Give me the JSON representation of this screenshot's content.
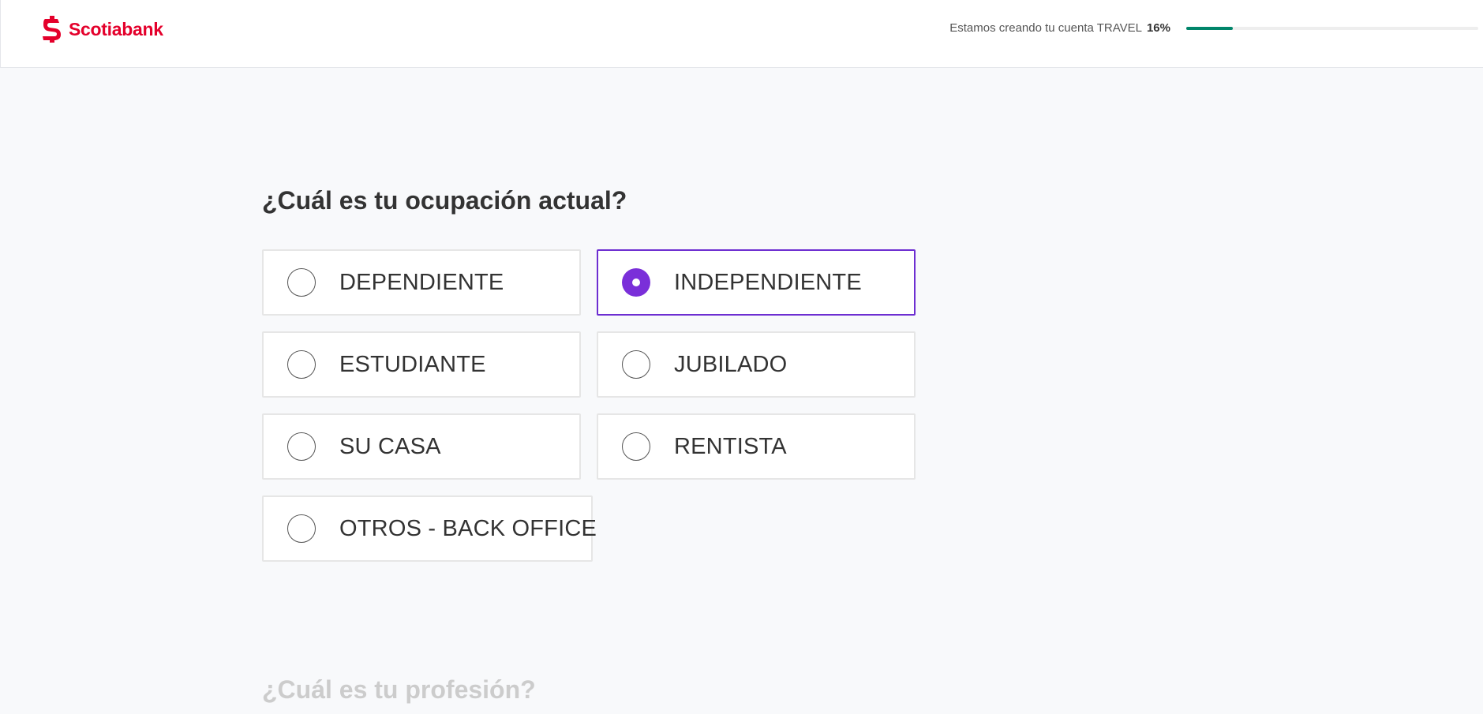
{
  "header": {
    "brand": "Scotiabank",
    "progress_label": "Estamos creando tu cuenta TRAVEL",
    "progress_percent_text": "16%",
    "progress_value": 0.16,
    "brand_color": "#e4002b",
    "progress_color": "#00856a"
  },
  "main": {
    "question": "¿Cuál es tu ocupación actual?",
    "options": [
      {
        "label": "DEPENDIENTE",
        "selected": false
      },
      {
        "label": "INDEPENDIENTE",
        "selected": true
      },
      {
        "label": "ESTUDIANTE",
        "selected": false
      },
      {
        "label": "JUBILADO",
        "selected": false
      },
      {
        "label": "SU CASA",
        "selected": false
      },
      {
        "label": "RENTISTA",
        "selected": false
      },
      {
        "label": "OTROS - BACK OFFICE",
        "selected": false
      }
    ],
    "next_question": "¿Cuál es tu profesión?",
    "accent_color": "#7a2fd9"
  }
}
